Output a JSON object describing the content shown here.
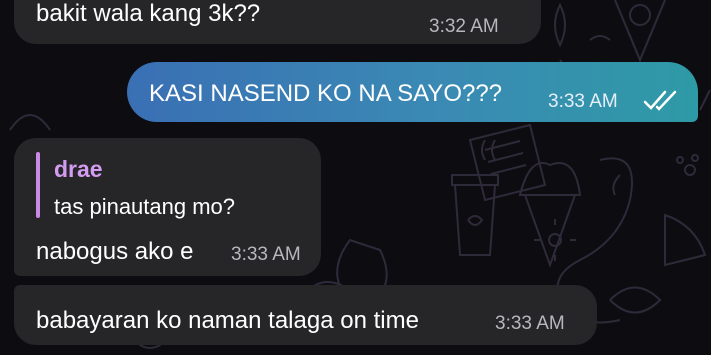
{
  "messages": [
    {
      "text": "bakit wala kang 3k??",
      "time": "3:32 AM",
      "direction": "incoming"
    },
    {
      "text": "KASI NASEND KO NA SAYO???",
      "time": "3:33 AM",
      "direction": "outgoing",
      "status": "read"
    },
    {
      "reply_to": {
        "name": "drae",
        "text": "tas pinautang mo?"
      },
      "text": "nabogus ako e",
      "time": "3:33 AM",
      "direction": "incoming"
    },
    {
      "text": "babayaran ko naman talaga on time",
      "time": "3:33 AM",
      "direction": "incoming"
    }
  ],
  "colors": {
    "background": "#0d0c10",
    "incoming_bubble": "#262629",
    "outgoing_gradient_start": "#3a6fb4",
    "outgoing_gradient_end": "#2e9aa6",
    "reply_accent": "#c88ae6"
  },
  "icons": [
    "double-check-icon"
  ]
}
